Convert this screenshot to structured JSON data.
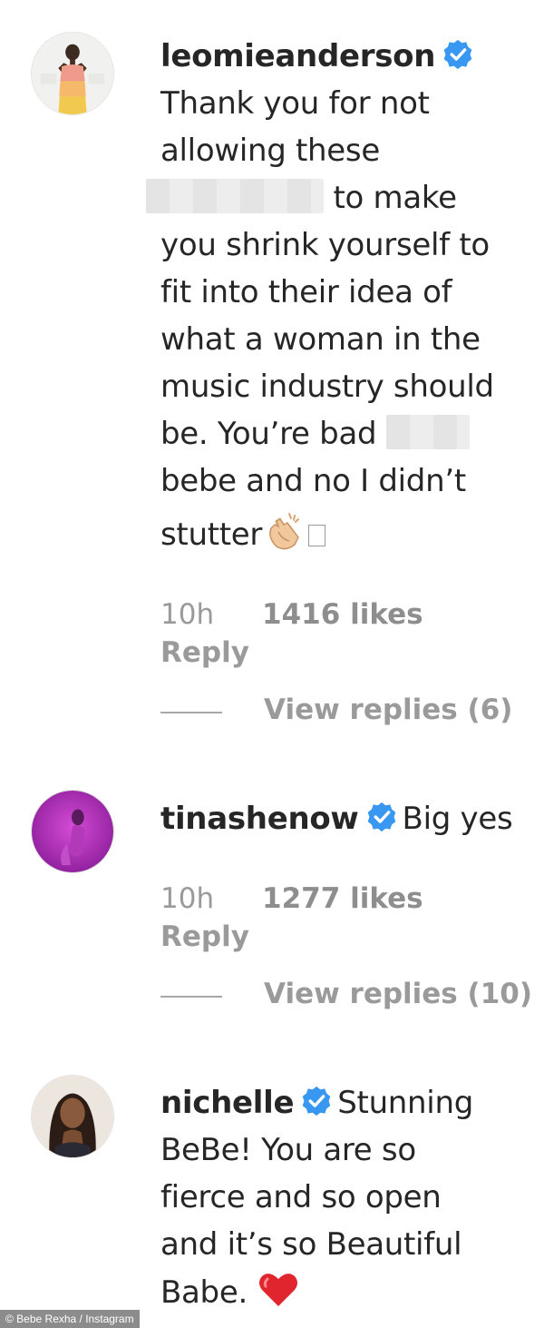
{
  "comments": [
    {
      "username": "leomieanderson",
      "verified": true,
      "text_lines": [
        "Thank you for not",
        "allowing these",
        "to make",
        "you shrink yourself to",
        "fit into their idea of",
        "what a woman in the",
        "music industry should",
        "be. You’re bad",
        "bebe and no I didn’t",
        "stutter"
      ],
      "time": "10h",
      "likes": "1416 likes",
      "reply": "Reply",
      "view_replies": "View replies (6)"
    },
    {
      "username": "tinashenow",
      "verified": true,
      "text": "Big yes",
      "time": "10h",
      "likes": "1277 likes",
      "reply": "Reply",
      "view_replies": "View replies (10)"
    },
    {
      "username": "nichelle",
      "verified": true,
      "text_lines": [
        "Stunning",
        "BeBe! You are so",
        "fierce and so open",
        "and it’s so Beautiful",
        "Babe."
      ]
    }
  ],
  "icons": {
    "verified": "verified-badge-icon",
    "clap": "clapping-hands-emoji-icon",
    "heart": "red-heart-emoji-icon",
    "verified_color": "#3897f0",
    "heart_color": "#e0252f"
  },
  "credit": "© Bebe Rexha / Instagram"
}
